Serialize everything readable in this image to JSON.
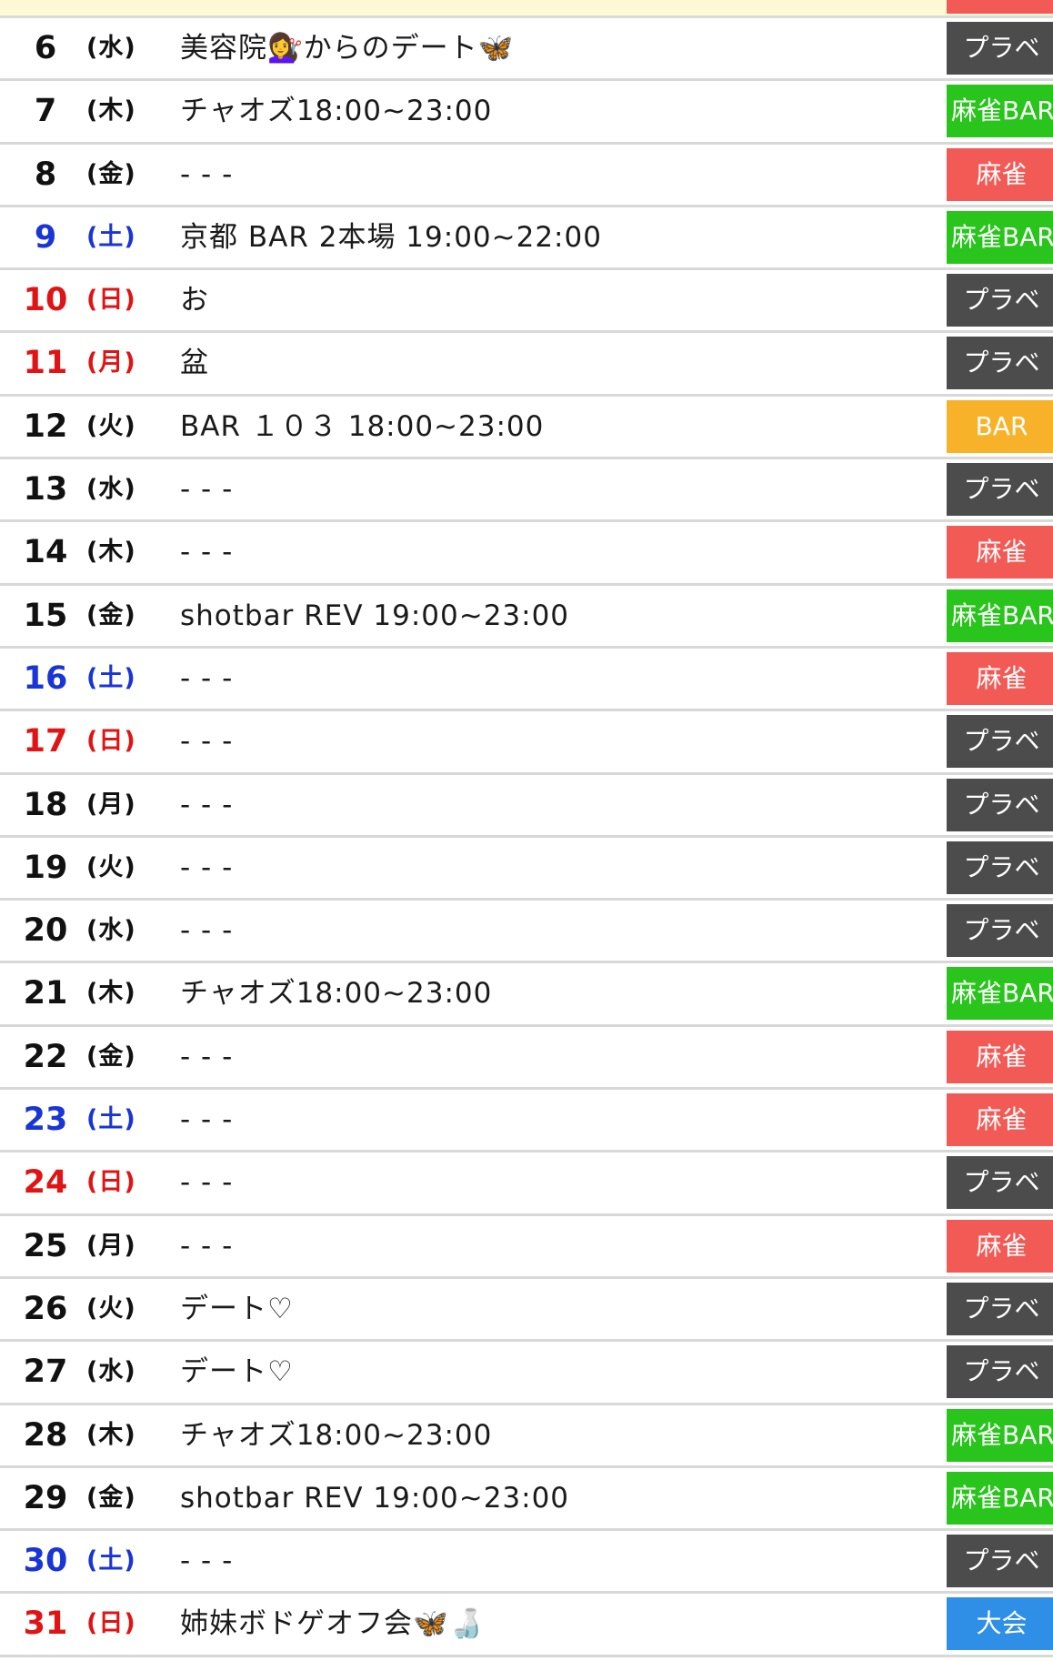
{
  "colors": {
    "prv": "#4c4c4c",
    "bar": "#29c51d",
    "mj": "#f25a55",
    "barOnly": "#f8b229",
    "taikai": "#2f8fe6",
    "saturday": "#1a35d6",
    "sunday": "#e01414"
  },
  "rows": [
    {
      "day": "6",
      "wd": "(水)",
      "event": "美容院💇‍♀️からのデート🦋",
      "tag": "プラベ",
      "type": "prv",
      "cls": ""
    },
    {
      "day": "7",
      "wd": "(木)",
      "event": "チャオズ18:00~23:00",
      "tag": "麻雀BAR",
      "type": "bar",
      "cls": ""
    },
    {
      "day": "8",
      "wd": "(金)",
      "event": "- - -",
      "tag": "麻雀",
      "type": "mj",
      "cls": ""
    },
    {
      "day": "9",
      "wd": "(土)",
      "event": "京都 BAR 2本場 19:00~22:00",
      "tag": "麻雀BAR",
      "type": "bar",
      "cls": "sat"
    },
    {
      "day": "10",
      "wd": "(日)",
      "event": "お",
      "tag": "プラベ",
      "type": "prv",
      "cls": "sun"
    },
    {
      "day": "11",
      "wd": "(月)",
      "event": "盆",
      "tag": "プラベ",
      "type": "prv",
      "cls": "sun"
    },
    {
      "day": "12",
      "wd": "(火)",
      "event": "BAR １０３ 18:00~23:00",
      "tag": "BAR",
      "type": "barOnly",
      "cls": ""
    },
    {
      "day": "13",
      "wd": "(水)",
      "event": "- - -",
      "tag": "プラベ",
      "type": "prv",
      "cls": ""
    },
    {
      "day": "14",
      "wd": "(木)",
      "event": "- - -",
      "tag": "麻雀",
      "type": "mj",
      "cls": ""
    },
    {
      "day": "15",
      "wd": "(金)",
      "event": "shotbar REV 19:00~23:00",
      "tag": "麻雀BAR",
      "type": "bar",
      "cls": ""
    },
    {
      "day": "16",
      "wd": "(土)",
      "event": "- - -",
      "tag": "麻雀",
      "type": "mj",
      "cls": "sat"
    },
    {
      "day": "17",
      "wd": "(日)",
      "event": "- - -",
      "tag": "プラベ",
      "type": "prv",
      "cls": "sun"
    },
    {
      "day": "18",
      "wd": "(月)",
      "event": "- - -",
      "tag": "プラベ",
      "type": "prv",
      "cls": ""
    },
    {
      "day": "19",
      "wd": "(火)",
      "event": "- - -",
      "tag": "プラベ",
      "type": "prv",
      "cls": ""
    },
    {
      "day": "20",
      "wd": "(水)",
      "event": "- - -",
      "tag": "プラベ",
      "type": "prv",
      "cls": ""
    },
    {
      "day": "21",
      "wd": "(木)",
      "event": "チャオズ18:00~23:00",
      "tag": "麻雀BAR",
      "type": "bar",
      "cls": ""
    },
    {
      "day": "22",
      "wd": "(金)",
      "event": "- - -",
      "tag": "麻雀",
      "type": "mj",
      "cls": ""
    },
    {
      "day": "23",
      "wd": "(土)",
      "event": "- - -",
      "tag": "麻雀",
      "type": "mj",
      "cls": "sat"
    },
    {
      "day": "24",
      "wd": "(日)",
      "event": "- - -",
      "tag": "プラベ",
      "type": "prv",
      "cls": "sun"
    },
    {
      "day": "25",
      "wd": "(月)",
      "event": "- - -",
      "tag": "麻雀",
      "type": "mj",
      "cls": ""
    },
    {
      "day": "26",
      "wd": "(火)",
      "event": "デート♡",
      "tag": "プラベ",
      "type": "prv",
      "cls": ""
    },
    {
      "day": "27",
      "wd": "(水)",
      "event": "デート♡",
      "tag": "プラベ",
      "type": "prv",
      "cls": ""
    },
    {
      "day": "28",
      "wd": "(木)",
      "event": "チャオズ18:00~23:00",
      "tag": "麻雀BAR",
      "type": "bar",
      "cls": ""
    },
    {
      "day": "29",
      "wd": "(金)",
      "event": "shotbar REV 19:00~23:00",
      "tag": "麻雀BAR",
      "type": "bar",
      "cls": ""
    },
    {
      "day": "30",
      "wd": "(土)",
      "event": "- - -",
      "tag": "プラベ",
      "type": "prv",
      "cls": "sat"
    },
    {
      "day": "31",
      "wd": "(日)",
      "event": "姉妹ボドゲオフ会🦋🍶",
      "tag": "大会",
      "type": "taikai",
      "cls": "sun"
    }
  ]
}
